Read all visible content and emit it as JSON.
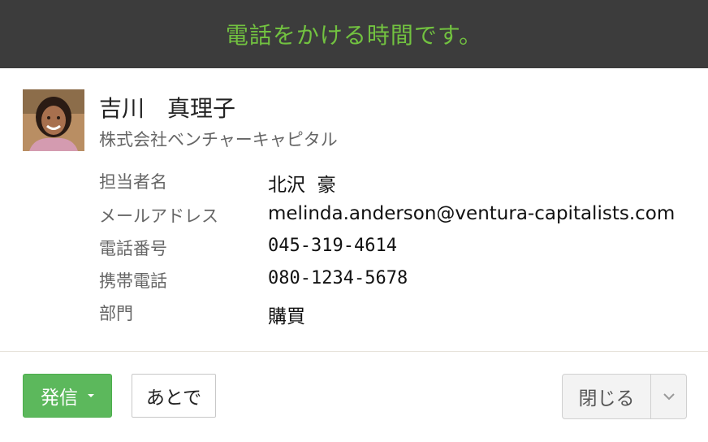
{
  "banner": {
    "title": "電話をかける時間です。"
  },
  "contact": {
    "name": "吉川　真理子",
    "company": "株式会社ベンチャーキャピタル",
    "avatar_icon": "person-photo"
  },
  "details": [
    {
      "label": "担当者名",
      "value": "北沢  豪"
    },
    {
      "label": "メールアドレス",
      "value": "melinda.anderson@ventura-capitalists.com"
    },
    {
      "label": "電話番号",
      "value": "045-319-4614"
    },
    {
      "label": "携帯電話",
      "value": "080-1234-5678"
    },
    {
      "label": "部門",
      "value": "購買"
    }
  ],
  "actions": {
    "call_label": "発信",
    "later_label": "あとで",
    "close_label": "閉じる",
    "call_dropdown_icon": "caret-down-icon",
    "close_dropdown_icon": "chevron-down-icon"
  },
  "colors": {
    "banner_bg": "#3c3c3c",
    "banner_text": "#72c240",
    "call_button": "#5cb85c"
  }
}
